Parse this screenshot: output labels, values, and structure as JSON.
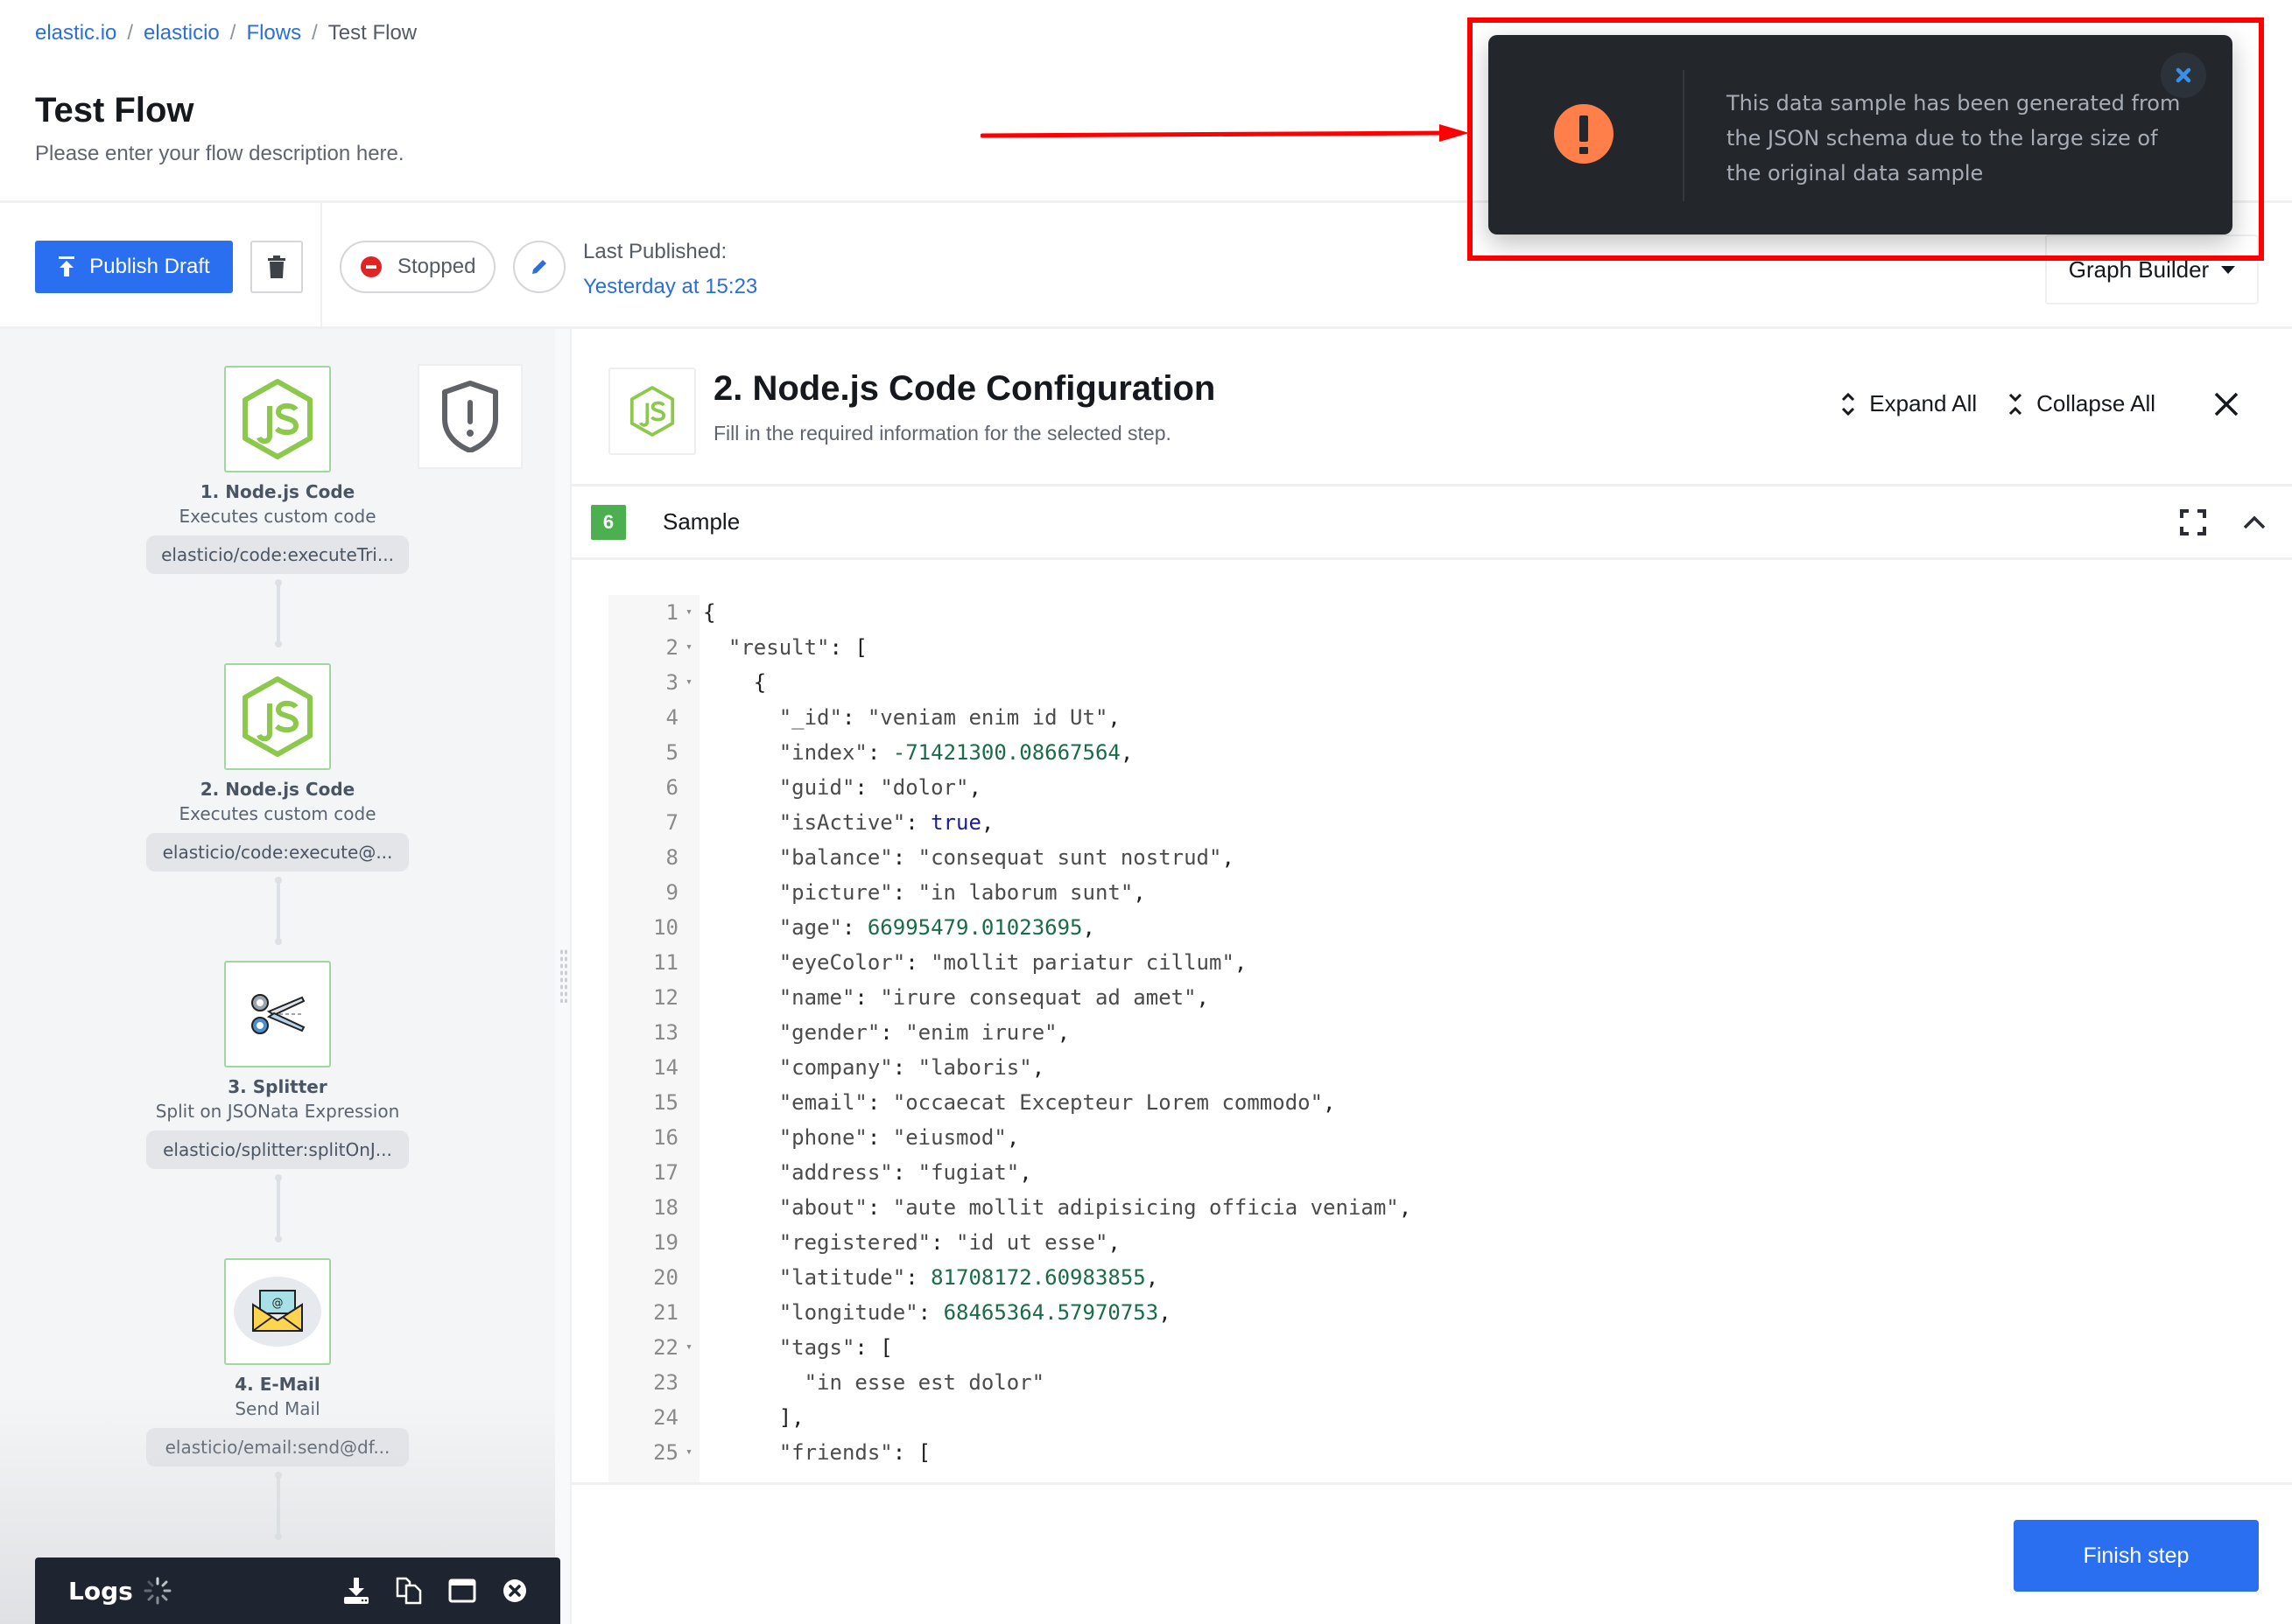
{
  "breadcrumb": [
    {
      "label": "elastic.io",
      "link": true
    },
    {
      "label": "elasticio",
      "link": true
    },
    {
      "label": "Flows",
      "link": true
    },
    {
      "label": "Test Flow",
      "link": false
    }
  ],
  "breadcrumb_separator": "/",
  "page": {
    "title": "Test Flow",
    "description": "Please enter your flow description here."
  },
  "toolbar": {
    "publish_label": "Publish Draft",
    "status_label": "Stopped",
    "last_published_label": "Last Published:",
    "last_published_value": "Yesterday at 15:23",
    "view_select": "Graph Builder"
  },
  "flow": {
    "nodes": [
      {
        "title": "1. Node.js Code",
        "subtitle": "Executes custom code",
        "tag": "elasticio/code:executeTri...",
        "icon": "nodejs-icon"
      },
      {
        "title": "2. Node.js Code",
        "subtitle": "Executes custom code",
        "tag": "elasticio/code:execute@...",
        "icon": "nodejs-icon"
      },
      {
        "title": "3. Splitter",
        "subtitle": "Split on JSONata Expression",
        "tag": "elasticio/splitter:splitOnJ...",
        "icon": "scissors-icon"
      },
      {
        "title": "4. E-Mail",
        "subtitle": "Send Mail",
        "tag": "elasticio/email:send@df...",
        "icon": "envelope-icon"
      }
    ]
  },
  "logs": {
    "title": "Logs",
    "icons": [
      "download-icon",
      "copy-icon",
      "window-icon",
      "close-circle-icon"
    ]
  },
  "panel": {
    "title": "2. Node.js Code Configuration",
    "subtitle": "Fill in the required information for the selected step.",
    "expand_all": "Expand All",
    "collapse_all": "Collapse All",
    "section": {
      "number": "6",
      "label": "Sample"
    },
    "finish_label": "Finish step"
  },
  "code_lines": [
    {
      "n": "1",
      "fold": true,
      "indent": 0,
      "tokens": [
        [
          "p",
          "{"
        ]
      ]
    },
    {
      "n": "2",
      "fold": true,
      "indent": 1,
      "tokens": [
        [
          "k",
          "\"result\""
        ],
        [
          "p",
          ": ["
        ]
      ]
    },
    {
      "n": "3",
      "fold": true,
      "indent": 2,
      "tokens": [
        [
          "p",
          "{"
        ]
      ]
    },
    {
      "n": "4",
      "fold": false,
      "indent": 3,
      "tokens": [
        [
          "k",
          "\"_id\""
        ],
        [
          "p",
          ": "
        ],
        [
          "s",
          "\"veniam enim id Ut\""
        ],
        [
          "p",
          ","
        ]
      ]
    },
    {
      "n": "5",
      "fold": false,
      "indent": 3,
      "tokens": [
        [
          "k",
          "\"index\""
        ],
        [
          "p",
          ": "
        ],
        [
          "n",
          "-71421300.08667564"
        ],
        [
          "p",
          ","
        ]
      ]
    },
    {
      "n": "6",
      "fold": false,
      "indent": 3,
      "tokens": [
        [
          "k",
          "\"guid\""
        ],
        [
          "p",
          ": "
        ],
        [
          "s",
          "\"dolor\""
        ],
        [
          "p",
          ","
        ]
      ]
    },
    {
      "n": "7",
      "fold": false,
      "indent": 3,
      "tokens": [
        [
          "k",
          "\"isActive\""
        ],
        [
          "p",
          ": "
        ],
        [
          "b",
          "true"
        ],
        [
          "p",
          ","
        ]
      ]
    },
    {
      "n": "8",
      "fold": false,
      "indent": 3,
      "tokens": [
        [
          "k",
          "\"balance\""
        ],
        [
          "p",
          ": "
        ],
        [
          "s",
          "\"consequat sunt nostrud\""
        ],
        [
          "p",
          ","
        ]
      ]
    },
    {
      "n": "9",
      "fold": false,
      "indent": 3,
      "tokens": [
        [
          "k",
          "\"picture\""
        ],
        [
          "p",
          ": "
        ],
        [
          "s",
          "\"in laborum sunt\""
        ],
        [
          "p",
          ","
        ]
      ]
    },
    {
      "n": "10",
      "fold": false,
      "indent": 3,
      "tokens": [
        [
          "k",
          "\"age\""
        ],
        [
          "p",
          ": "
        ],
        [
          "n",
          "66995479.01023695"
        ],
        [
          "p",
          ","
        ]
      ]
    },
    {
      "n": "11",
      "fold": false,
      "indent": 3,
      "tokens": [
        [
          "k",
          "\"eyeColor\""
        ],
        [
          "p",
          ": "
        ],
        [
          "s",
          "\"mollit pariatur cillum\""
        ],
        [
          "p",
          ","
        ]
      ]
    },
    {
      "n": "12",
      "fold": false,
      "indent": 3,
      "tokens": [
        [
          "k",
          "\"name\""
        ],
        [
          "p",
          ": "
        ],
        [
          "s",
          "\"irure consequat ad amet\""
        ],
        [
          "p",
          ","
        ]
      ]
    },
    {
      "n": "13",
      "fold": false,
      "indent": 3,
      "tokens": [
        [
          "k",
          "\"gender\""
        ],
        [
          "p",
          ": "
        ],
        [
          "s",
          "\"enim irure\""
        ],
        [
          "p",
          ","
        ]
      ]
    },
    {
      "n": "14",
      "fold": false,
      "indent": 3,
      "tokens": [
        [
          "k",
          "\"company\""
        ],
        [
          "p",
          ": "
        ],
        [
          "s",
          "\"laboris\""
        ],
        [
          "p",
          ","
        ]
      ]
    },
    {
      "n": "15",
      "fold": false,
      "indent": 3,
      "tokens": [
        [
          "k",
          "\"email\""
        ],
        [
          "p",
          ": "
        ],
        [
          "s",
          "\"occaecat Excepteur Lorem commodo\""
        ],
        [
          "p",
          ","
        ]
      ]
    },
    {
      "n": "16",
      "fold": false,
      "indent": 3,
      "tokens": [
        [
          "k",
          "\"phone\""
        ],
        [
          "p",
          ": "
        ],
        [
          "s",
          "\"eiusmod\""
        ],
        [
          "p",
          ","
        ]
      ]
    },
    {
      "n": "17",
      "fold": false,
      "indent": 3,
      "tokens": [
        [
          "k",
          "\"address\""
        ],
        [
          "p",
          ": "
        ],
        [
          "s",
          "\"fugiat\""
        ],
        [
          "p",
          ","
        ]
      ]
    },
    {
      "n": "18",
      "fold": false,
      "indent": 3,
      "tokens": [
        [
          "k",
          "\"about\""
        ],
        [
          "p",
          ": "
        ],
        [
          "s",
          "\"aute mollit adipisicing officia veniam\""
        ],
        [
          "p",
          ","
        ]
      ]
    },
    {
      "n": "19",
      "fold": false,
      "indent": 3,
      "tokens": [
        [
          "k",
          "\"registered\""
        ],
        [
          "p",
          ": "
        ],
        [
          "s",
          "\"id ut esse\""
        ],
        [
          "p",
          ","
        ]
      ]
    },
    {
      "n": "20",
      "fold": false,
      "indent": 3,
      "tokens": [
        [
          "k",
          "\"latitude\""
        ],
        [
          "p",
          ": "
        ],
        [
          "n",
          "81708172.60983855"
        ],
        [
          "p",
          ","
        ]
      ]
    },
    {
      "n": "21",
      "fold": false,
      "indent": 3,
      "tokens": [
        [
          "k",
          "\"longitude\""
        ],
        [
          "p",
          ": "
        ],
        [
          "n",
          "68465364.57970753"
        ],
        [
          "p",
          ","
        ]
      ]
    },
    {
      "n": "22",
      "fold": true,
      "indent": 3,
      "tokens": [
        [
          "k",
          "\"tags\""
        ],
        [
          "p",
          ": ["
        ]
      ]
    },
    {
      "n": "23",
      "fold": false,
      "indent": 4,
      "tokens": [
        [
          "s",
          "\"in esse est dolor\""
        ]
      ]
    },
    {
      "n": "24",
      "fold": false,
      "indent": 3,
      "tokens": [
        [
          "p",
          "],"
        ]
      ]
    },
    {
      "n": "25",
      "fold": true,
      "indent": 3,
      "tokens": [
        [
          "k",
          "\"friends\""
        ],
        [
          "p",
          ": ["
        ]
      ]
    }
  ],
  "toast": {
    "message": "This data sample has been generated from the JSON schema due to the large size of the original data sample",
    "type": "warning"
  },
  "colors": {
    "primary": "#2a6ff0",
    "link": "#2a6fdb",
    "stopped": "#e02424",
    "warning": "#ff7f4a",
    "node_border": "#9ed89e",
    "section_badge": "#4caf50",
    "toast_bg": "#23272c",
    "annotation": "#ff0000",
    "nodejs_green": "#8cc84b"
  }
}
